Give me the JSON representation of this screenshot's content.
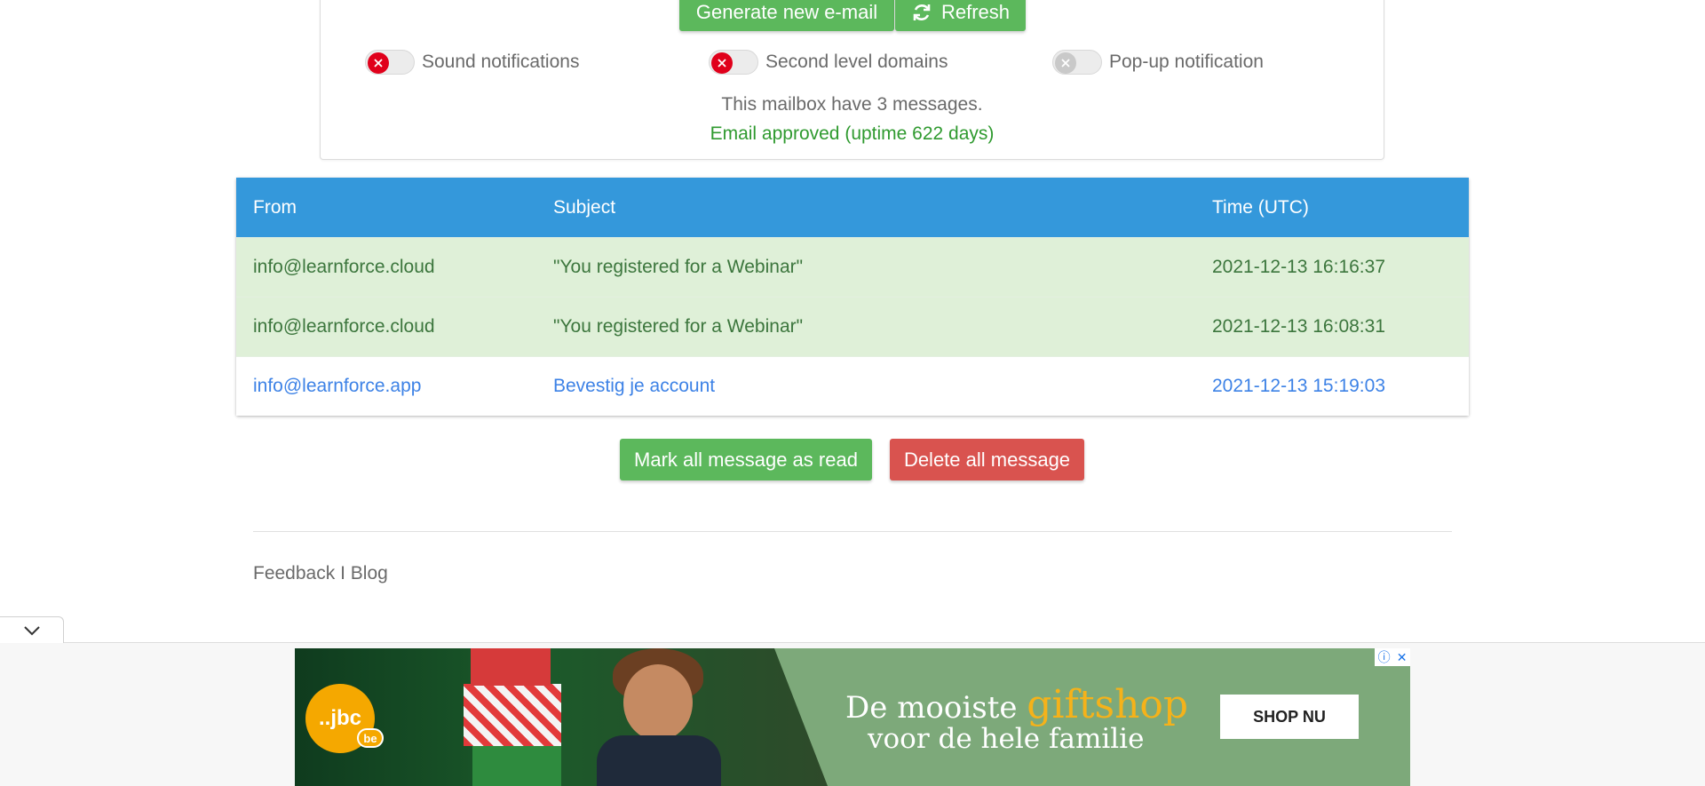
{
  "toolbar": {
    "generate_label": "Generate new e-mail",
    "refresh_label": "Refresh"
  },
  "settings": {
    "sound_label": "Sound notifications",
    "second_level_label": "Second level domains",
    "popup_label": "Pop-up notification"
  },
  "status": {
    "message_count": "This mailbox have 3 messages.",
    "approved": "Email approved (uptime 622 days)"
  },
  "table": {
    "headers": {
      "from": "From",
      "subject": "Subject",
      "time": "Time (UTC)"
    },
    "rows": [
      {
        "from": "info@learnforce.cloud",
        "subject": "\"You registered for a Webinar\"",
        "time": "2021-12-13 16:16:37"
      },
      {
        "from": "info@learnforce.cloud",
        "subject": "\"You registered for a Webinar\"",
        "time": "2021-12-13 16:08:31"
      },
      {
        "from": "info@learnforce.app",
        "subject": "Bevestig je account",
        "time": "2021-12-13 15:19:03"
      }
    ]
  },
  "actions": {
    "mark_read_label": "Mark all message as read",
    "delete_all_label": "Delete all message"
  },
  "footer": {
    "feedback": "Feedback",
    "separator": "I",
    "blog": "Blog"
  },
  "ad": {
    "logo": "..jbc",
    "logo_sub": "be",
    "line1_prefix": "De mooiste ",
    "line1_highlight": "giftshop",
    "line2": "voor de hele familie",
    "cta": "SHOP NU"
  },
  "colors": {
    "primary_green": "#5cb85c",
    "danger_red": "#d9534f",
    "header_blue": "#3498db",
    "read_row_bg": "#dff0d8",
    "unread_link": "#3d82e6"
  }
}
